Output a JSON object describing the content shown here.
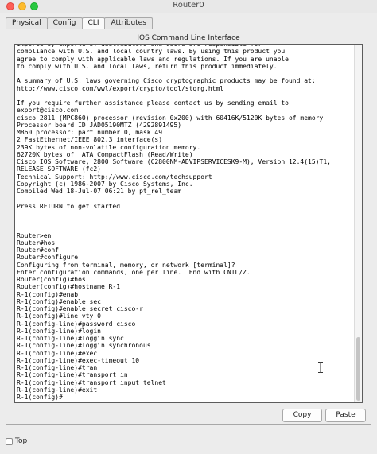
{
  "window": {
    "title": "Router0"
  },
  "tabs": [
    {
      "label": "Physical"
    },
    {
      "label": "Config"
    },
    {
      "label": "CLI"
    },
    {
      "label": "Attributes"
    }
  ],
  "panel": {
    "title": "IOS Command Line Interface"
  },
  "console": {
    "lines": [
      "importers, exporters, distributors and users are responsible for",
      "compliance with U.S. and local country laws. By using this product you",
      "agree to comply with applicable laws and regulations. If you are unable",
      "to comply with U.S. and local laws, return this product immediately.",
      "",
      "A summary of U.S. laws governing Cisco cryptographic products may be found at:",
      "http://www.cisco.com/wwl/export/crypto/tool/stqrg.html",
      "",
      "If you require further assistance please contact us by sending email to",
      "export@cisco.com.",
      "cisco 2811 (MPC860) processor (revision 0x200) with 60416K/5120K bytes of memory",
      "Processor board ID JAD05190MTZ (4292891495)",
      "M860 processor: part number 0, mask 49",
      "2 FastEthernet/IEEE 802.3 interface(s)",
      "239K bytes of non-volatile configuration memory.",
      "62720K bytes of  ATA CompactFlash (Read/Write)",
      "Cisco IOS Software, 2800 Software (C2800NM-ADVIPSERVICESK9-M), Version 12.4(15)T1,",
      "RELEASE SOFTWARE (fc2)",
      "Technical Support: http://www.cisco.com/techsupport",
      "Copyright (c) 1986-2007 by Cisco Systems, Inc.",
      "Compiled Wed 18-Jul-07 06:21 by pt_rel_team",
      "",
      "Press RETURN to get started!",
      "",
      "",
      "",
      "Router>en",
      "Router#hos",
      "Router#conf",
      "Router#configure",
      "Configuring from terminal, memory, or network [terminal]?",
      "Enter configuration commands, one per line.  End with CNTL/Z.",
      "Router(config)#hos",
      "Router(config)#hostname R-1",
      "R-1(config)#enab",
      "R-1(config)#enable sec",
      "R-1(config)#enable secret cisco-r",
      "R-1(config)#line vty 0",
      "R-1(config-line)#password cisco",
      "R-1(config-line)#login",
      "R-1(config-line)#loggin sync",
      "R-1(config-line)#loggin synchronous",
      "R-1(config-line)#exec",
      "R-1(config-line)#exec-timeout 10",
      "R-1(config-line)#tran",
      "R-1(config-line)#transport in",
      "R-1(config-line)#transport input telnet",
      "R-1(config-line)#exit",
      "R-1(config)#"
    ]
  },
  "buttons": {
    "copy": "Copy",
    "paste": "Paste"
  },
  "footer": {
    "top_label": "Top"
  },
  "icons": {
    "close": "window-close-icon",
    "minimize": "window-minimize-icon",
    "maximize": "window-maximize-icon",
    "cursor": "text-cursor-icon"
  }
}
